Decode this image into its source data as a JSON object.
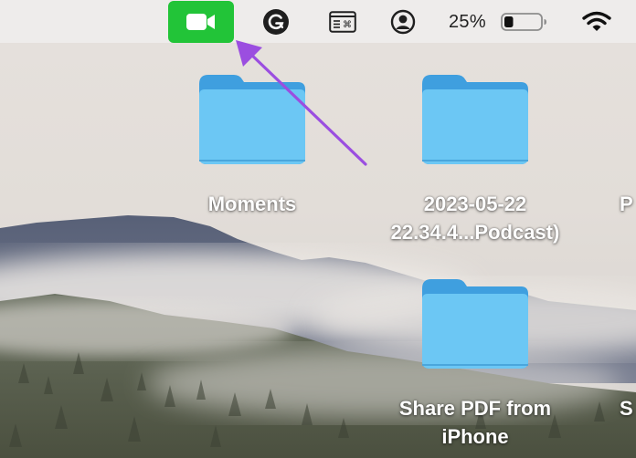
{
  "menubar": {
    "items": [
      {
        "name": "facetime-video-icon",
        "highlight_color": "#22c438"
      },
      {
        "name": "grammarly-icon"
      },
      {
        "name": "keyboard-shortcuts-icon"
      },
      {
        "name": "user-account-icon"
      }
    ],
    "battery": {
      "percent_label": "25%",
      "level": 0.25
    },
    "wifi_icon": "wifi-icon"
  },
  "desktop": {
    "folders": [
      {
        "label_lines": [
          "Moments"
        ]
      },
      {
        "label_lines": [
          "2023-05-22",
          "22.34.4...Podcast)"
        ]
      },
      {
        "label_lines": [
          "P"
        ]
      },
      {
        "label_lines": [
          "Share PDF from",
          "iPhone"
        ]
      },
      {
        "label_lines": [
          "S"
        ]
      }
    ],
    "folder_color": "#6cc7f4"
  },
  "annotation": {
    "arrow_color": "#9b4ee0"
  }
}
